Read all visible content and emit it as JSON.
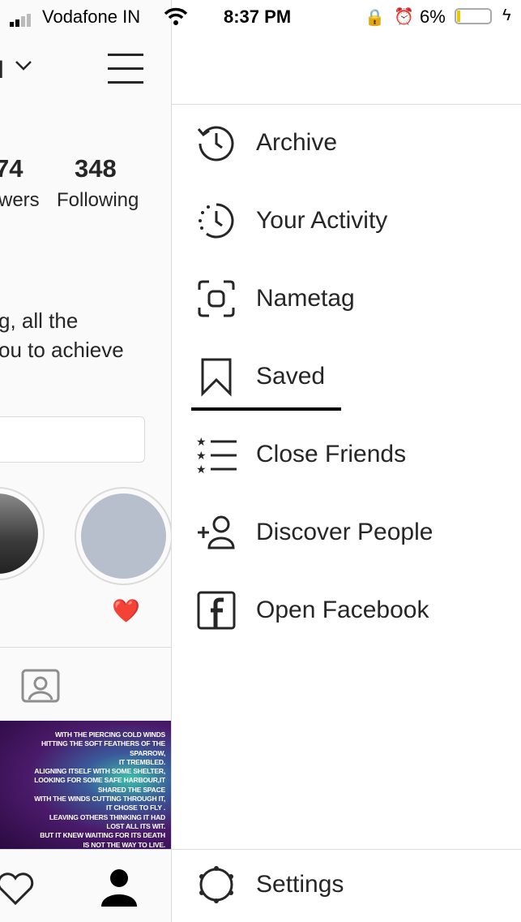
{
  "status": {
    "carrier": "Vodafone IN",
    "time": "8:37 PM",
    "battery": "6%",
    "battery_level": 0.06
  },
  "profile": {
    "username_fragment": "l",
    "followers_count": "74",
    "followers_label": "wers",
    "following_count": "348",
    "following_label": "Following",
    "bio_line1": "g, all the",
    "bio_line2": "ou to achieve",
    "highlight_emoji": "❤️",
    "post_text": [
      "WITH THE PIERCING COLD WINDS",
      "HITTING THE SOFT FEATHERS OF THE",
      "SPARROW,",
      "IT TREMBLED.",
      "ALIGNING ITSELF WITH SOME SHELTER,",
      "LOOKING FOR SOME SAFE HARBOUR,IT",
      "SHARED THE SPACE",
      "WITH THE WINDS CUTTING THROUGH IT,",
      "IT CHOSE TO FLY .",
      "LEAVING OTHERS THINKING IT HAD",
      "LOST ALL ITS WIT.",
      "BUT IT KNEW WAITING FOR ITS DEATH",
      "IS NOT THE WAY TO LIVE."
    ]
  },
  "menu": {
    "items": [
      {
        "label": "Archive",
        "icon": "archive-icon"
      },
      {
        "label": "Your Activity",
        "icon": "activity-icon"
      },
      {
        "label": "Nametag",
        "icon": "nametag-icon"
      },
      {
        "label": "Saved",
        "icon": "bookmark-icon"
      },
      {
        "label": "Close Friends",
        "icon": "close-friends-icon"
      },
      {
        "label": "Discover People",
        "icon": "add-person-icon"
      },
      {
        "label": "Open Facebook",
        "icon": "facebook-icon"
      }
    ],
    "settings_label": "Settings"
  }
}
